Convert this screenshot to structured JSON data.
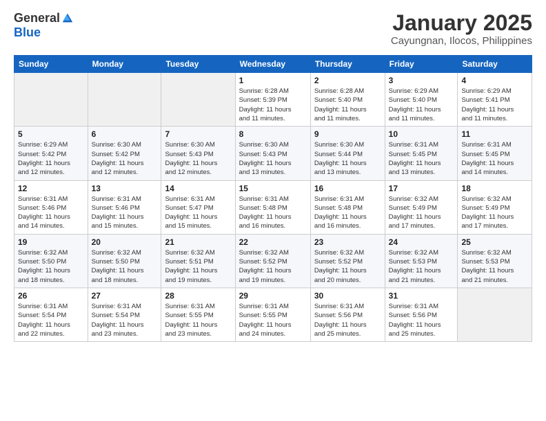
{
  "header": {
    "logo_general": "General",
    "logo_blue": "Blue",
    "month_title": "January 2025",
    "location": "Cayungnan, Ilocos, Philippines"
  },
  "weekdays": [
    "Sunday",
    "Monday",
    "Tuesday",
    "Wednesday",
    "Thursday",
    "Friday",
    "Saturday"
  ],
  "weeks": [
    [
      {
        "day": "",
        "info": ""
      },
      {
        "day": "",
        "info": ""
      },
      {
        "day": "",
        "info": ""
      },
      {
        "day": "1",
        "info": "Sunrise: 6:28 AM\nSunset: 5:39 PM\nDaylight: 11 hours\nand 11 minutes."
      },
      {
        "day": "2",
        "info": "Sunrise: 6:28 AM\nSunset: 5:40 PM\nDaylight: 11 hours\nand 11 minutes."
      },
      {
        "day": "3",
        "info": "Sunrise: 6:29 AM\nSunset: 5:40 PM\nDaylight: 11 hours\nand 11 minutes."
      },
      {
        "day": "4",
        "info": "Sunrise: 6:29 AM\nSunset: 5:41 PM\nDaylight: 11 hours\nand 11 minutes."
      }
    ],
    [
      {
        "day": "5",
        "info": "Sunrise: 6:29 AM\nSunset: 5:42 PM\nDaylight: 11 hours\nand 12 minutes."
      },
      {
        "day": "6",
        "info": "Sunrise: 6:30 AM\nSunset: 5:42 PM\nDaylight: 11 hours\nand 12 minutes."
      },
      {
        "day": "7",
        "info": "Sunrise: 6:30 AM\nSunset: 5:43 PM\nDaylight: 11 hours\nand 12 minutes."
      },
      {
        "day": "8",
        "info": "Sunrise: 6:30 AM\nSunset: 5:43 PM\nDaylight: 11 hours\nand 13 minutes."
      },
      {
        "day": "9",
        "info": "Sunrise: 6:30 AM\nSunset: 5:44 PM\nDaylight: 11 hours\nand 13 minutes."
      },
      {
        "day": "10",
        "info": "Sunrise: 6:31 AM\nSunset: 5:45 PM\nDaylight: 11 hours\nand 13 minutes."
      },
      {
        "day": "11",
        "info": "Sunrise: 6:31 AM\nSunset: 5:45 PM\nDaylight: 11 hours\nand 14 minutes."
      }
    ],
    [
      {
        "day": "12",
        "info": "Sunrise: 6:31 AM\nSunset: 5:46 PM\nDaylight: 11 hours\nand 14 minutes."
      },
      {
        "day": "13",
        "info": "Sunrise: 6:31 AM\nSunset: 5:46 PM\nDaylight: 11 hours\nand 15 minutes."
      },
      {
        "day": "14",
        "info": "Sunrise: 6:31 AM\nSunset: 5:47 PM\nDaylight: 11 hours\nand 15 minutes."
      },
      {
        "day": "15",
        "info": "Sunrise: 6:31 AM\nSunset: 5:48 PM\nDaylight: 11 hours\nand 16 minutes."
      },
      {
        "day": "16",
        "info": "Sunrise: 6:31 AM\nSunset: 5:48 PM\nDaylight: 11 hours\nand 16 minutes."
      },
      {
        "day": "17",
        "info": "Sunrise: 6:32 AM\nSunset: 5:49 PM\nDaylight: 11 hours\nand 17 minutes."
      },
      {
        "day": "18",
        "info": "Sunrise: 6:32 AM\nSunset: 5:49 PM\nDaylight: 11 hours\nand 17 minutes."
      }
    ],
    [
      {
        "day": "19",
        "info": "Sunrise: 6:32 AM\nSunset: 5:50 PM\nDaylight: 11 hours\nand 18 minutes."
      },
      {
        "day": "20",
        "info": "Sunrise: 6:32 AM\nSunset: 5:50 PM\nDaylight: 11 hours\nand 18 minutes."
      },
      {
        "day": "21",
        "info": "Sunrise: 6:32 AM\nSunset: 5:51 PM\nDaylight: 11 hours\nand 19 minutes."
      },
      {
        "day": "22",
        "info": "Sunrise: 6:32 AM\nSunset: 5:52 PM\nDaylight: 11 hours\nand 19 minutes."
      },
      {
        "day": "23",
        "info": "Sunrise: 6:32 AM\nSunset: 5:52 PM\nDaylight: 11 hours\nand 20 minutes."
      },
      {
        "day": "24",
        "info": "Sunrise: 6:32 AM\nSunset: 5:53 PM\nDaylight: 11 hours\nand 21 minutes."
      },
      {
        "day": "25",
        "info": "Sunrise: 6:32 AM\nSunset: 5:53 PM\nDaylight: 11 hours\nand 21 minutes."
      }
    ],
    [
      {
        "day": "26",
        "info": "Sunrise: 6:31 AM\nSunset: 5:54 PM\nDaylight: 11 hours\nand 22 minutes."
      },
      {
        "day": "27",
        "info": "Sunrise: 6:31 AM\nSunset: 5:54 PM\nDaylight: 11 hours\nand 23 minutes."
      },
      {
        "day": "28",
        "info": "Sunrise: 6:31 AM\nSunset: 5:55 PM\nDaylight: 11 hours\nand 23 minutes."
      },
      {
        "day": "29",
        "info": "Sunrise: 6:31 AM\nSunset: 5:55 PM\nDaylight: 11 hours\nand 24 minutes."
      },
      {
        "day": "30",
        "info": "Sunrise: 6:31 AM\nSunset: 5:56 PM\nDaylight: 11 hours\nand 25 minutes."
      },
      {
        "day": "31",
        "info": "Sunrise: 6:31 AM\nSunset: 5:56 PM\nDaylight: 11 hours\nand 25 minutes."
      },
      {
        "day": "",
        "info": ""
      }
    ]
  ]
}
